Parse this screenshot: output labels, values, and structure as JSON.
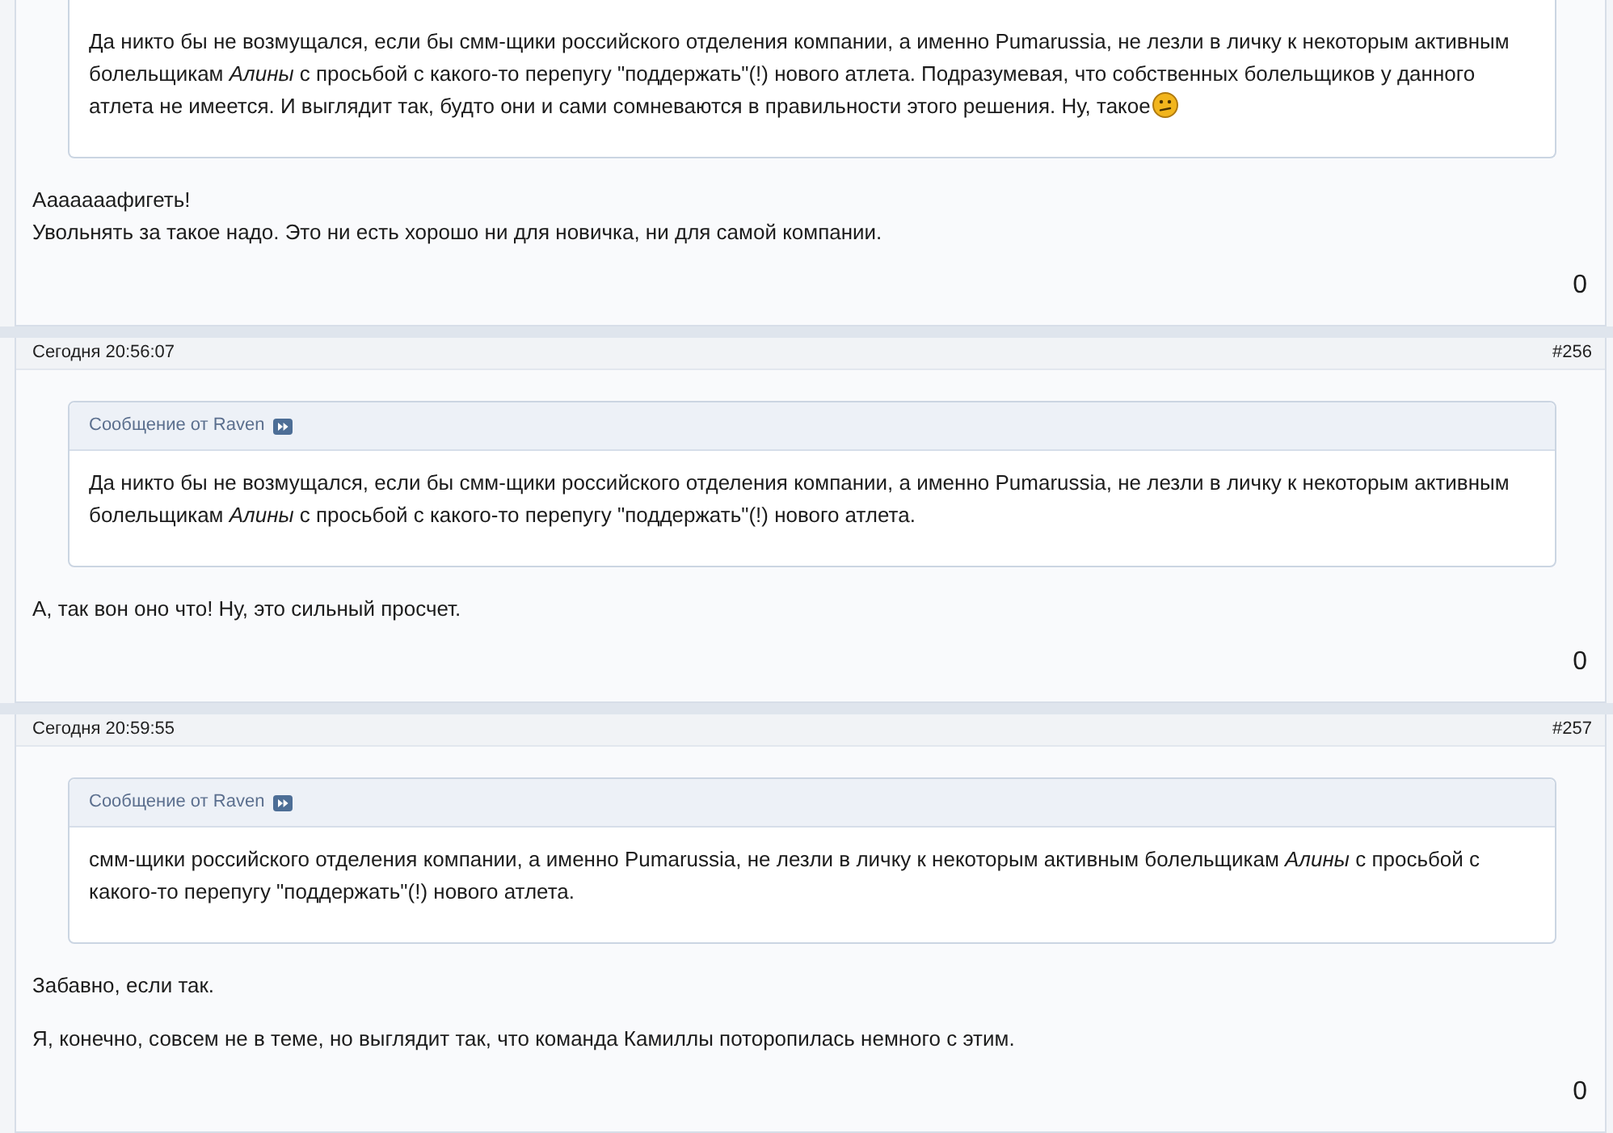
{
  "posts": [
    {
      "quote": {
        "text": "Да никто бы не возмущался, если бы смм-щики российского отделения компании, а именно Pumarussia, не лезли в личку к некоторым активным болельщикам *Алины* с просьбой с какого-то перепугу \"поддержать\"(!) нового атлета. Подразумевая, что собственных болельщиков у данного атлета не имеется. И выглядит так, будто они и сами сомневаются в правильности этого решения. Ну, такое",
        "smiley": true
      },
      "message": [
        {
          "lines": [
            "Ааааааафигеть!",
            "Увольнять за такое надо. Это ни есть хорошо ни для новичка, ни для самой компании."
          ]
        }
      ],
      "likes": "0"
    },
    {
      "date": "Сегодня 20:56:07",
      "number": "#256",
      "quote": {
        "author": "Сообщение от Raven",
        "text": "Да никто бы не возмущался, если бы смм-щики российского отделения компании, а именно Pumarussia, не лезли в личку к некоторым активным болельщикам *Алины* с просьбой с какого-то перепугу \"поддержать\"(!) нового атлета."
      },
      "message": [
        {
          "lines": [
            "А, так вон оно что! Ну, это сильный просчет."
          ]
        }
      ],
      "likes": "0"
    },
    {
      "date": "Сегодня 20:59:55",
      "number": "#257",
      "quote": {
        "author": "Сообщение от Raven",
        "text": "смм-щики российского отделения компании, а именно Pumarussia, не лезли в личку к некоторым активным болельщикам *Алины* с просьбой с какого-то перепугу \"поддержать\"(!) нового атлета."
      },
      "message": [
        {
          "lines": [
            "Забавно, если так."
          ]
        },
        {
          "lines": [
            "Я, конечно, совсем не в теме, но выглядит так, что команда Камиллы поторопилась немного с этим."
          ]
        }
      ],
      "likes": "0"
    }
  ]
}
